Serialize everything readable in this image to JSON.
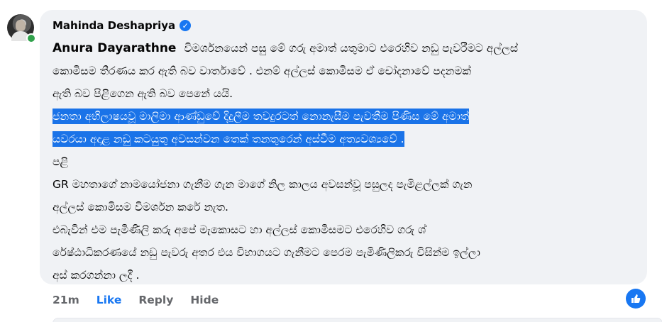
{
  "comment": {
    "author": "Mahinda Deshapriya",
    "mention": "Anura Dayarathne",
    "lines": [
      "විමර්ශනයෙන් පසු මේ ගරු අමාත් යතුමාට එරෙහිව නඩු පැවරීමට අල්ලස්",
      "කොමිසම තීරණය කර ඇති බව වාර්තාවේ . එනම් අල්ලස් කොමිසම ඒ චෝදනාවේ පදනමක්",
      "ඇති බව පිළිගෙන ඇති බව පෙනේ යයි.",
      "ජනතා අභිලාෂයවූ මාලිමා ආණ්ඩුවේ දිදුලීම තවදුරටත් නොනැසීම පැවතීම පිණිස මේ අමාත්",
      "යවරයා අදාළ නඩු කටයුතු අවසන්වන තෙක් තනතුරෙන් අස්වීම අත්‍යවශ්‍යවේ .",
      "පළි",
      "GR මහතාගේ නාමයෝජනා ගැනීම ගැන මාගේ නිල කාලය අවසන්වූ පසුලද පැමිළල්ලක් ගැන",
      "අල්ලස් කොමිසම විමර්ශන කරේ නැත.",
      "එබැවින් එම පැමිණිලි කරු අපේ මැකොසට හා අල්ලස් කොමිසමට එරෙහිව ගරු ශ්",
      "රේෂ්ඨාධිකරණයේ නඩු පැවරු අතර එය විභාගයට ගැනීමට පෙරම පැමිණිලිකරු විසින්ම ඉල්ලා",
      "අස් කරගන්නා ලදී ."
    ]
  },
  "actions": {
    "timestamp": "21m",
    "like": "Like",
    "reply": "Reply",
    "hide": "Hide"
  },
  "colors": {
    "bubble": "#f0f2f5",
    "accent": "#1877f2",
    "highlight": "#1a73e8",
    "muted": "#65676b",
    "online": "#31a24c"
  },
  "icons": {
    "verified": "verified-badge-icon",
    "reaction": "thumbs-up-icon"
  }
}
